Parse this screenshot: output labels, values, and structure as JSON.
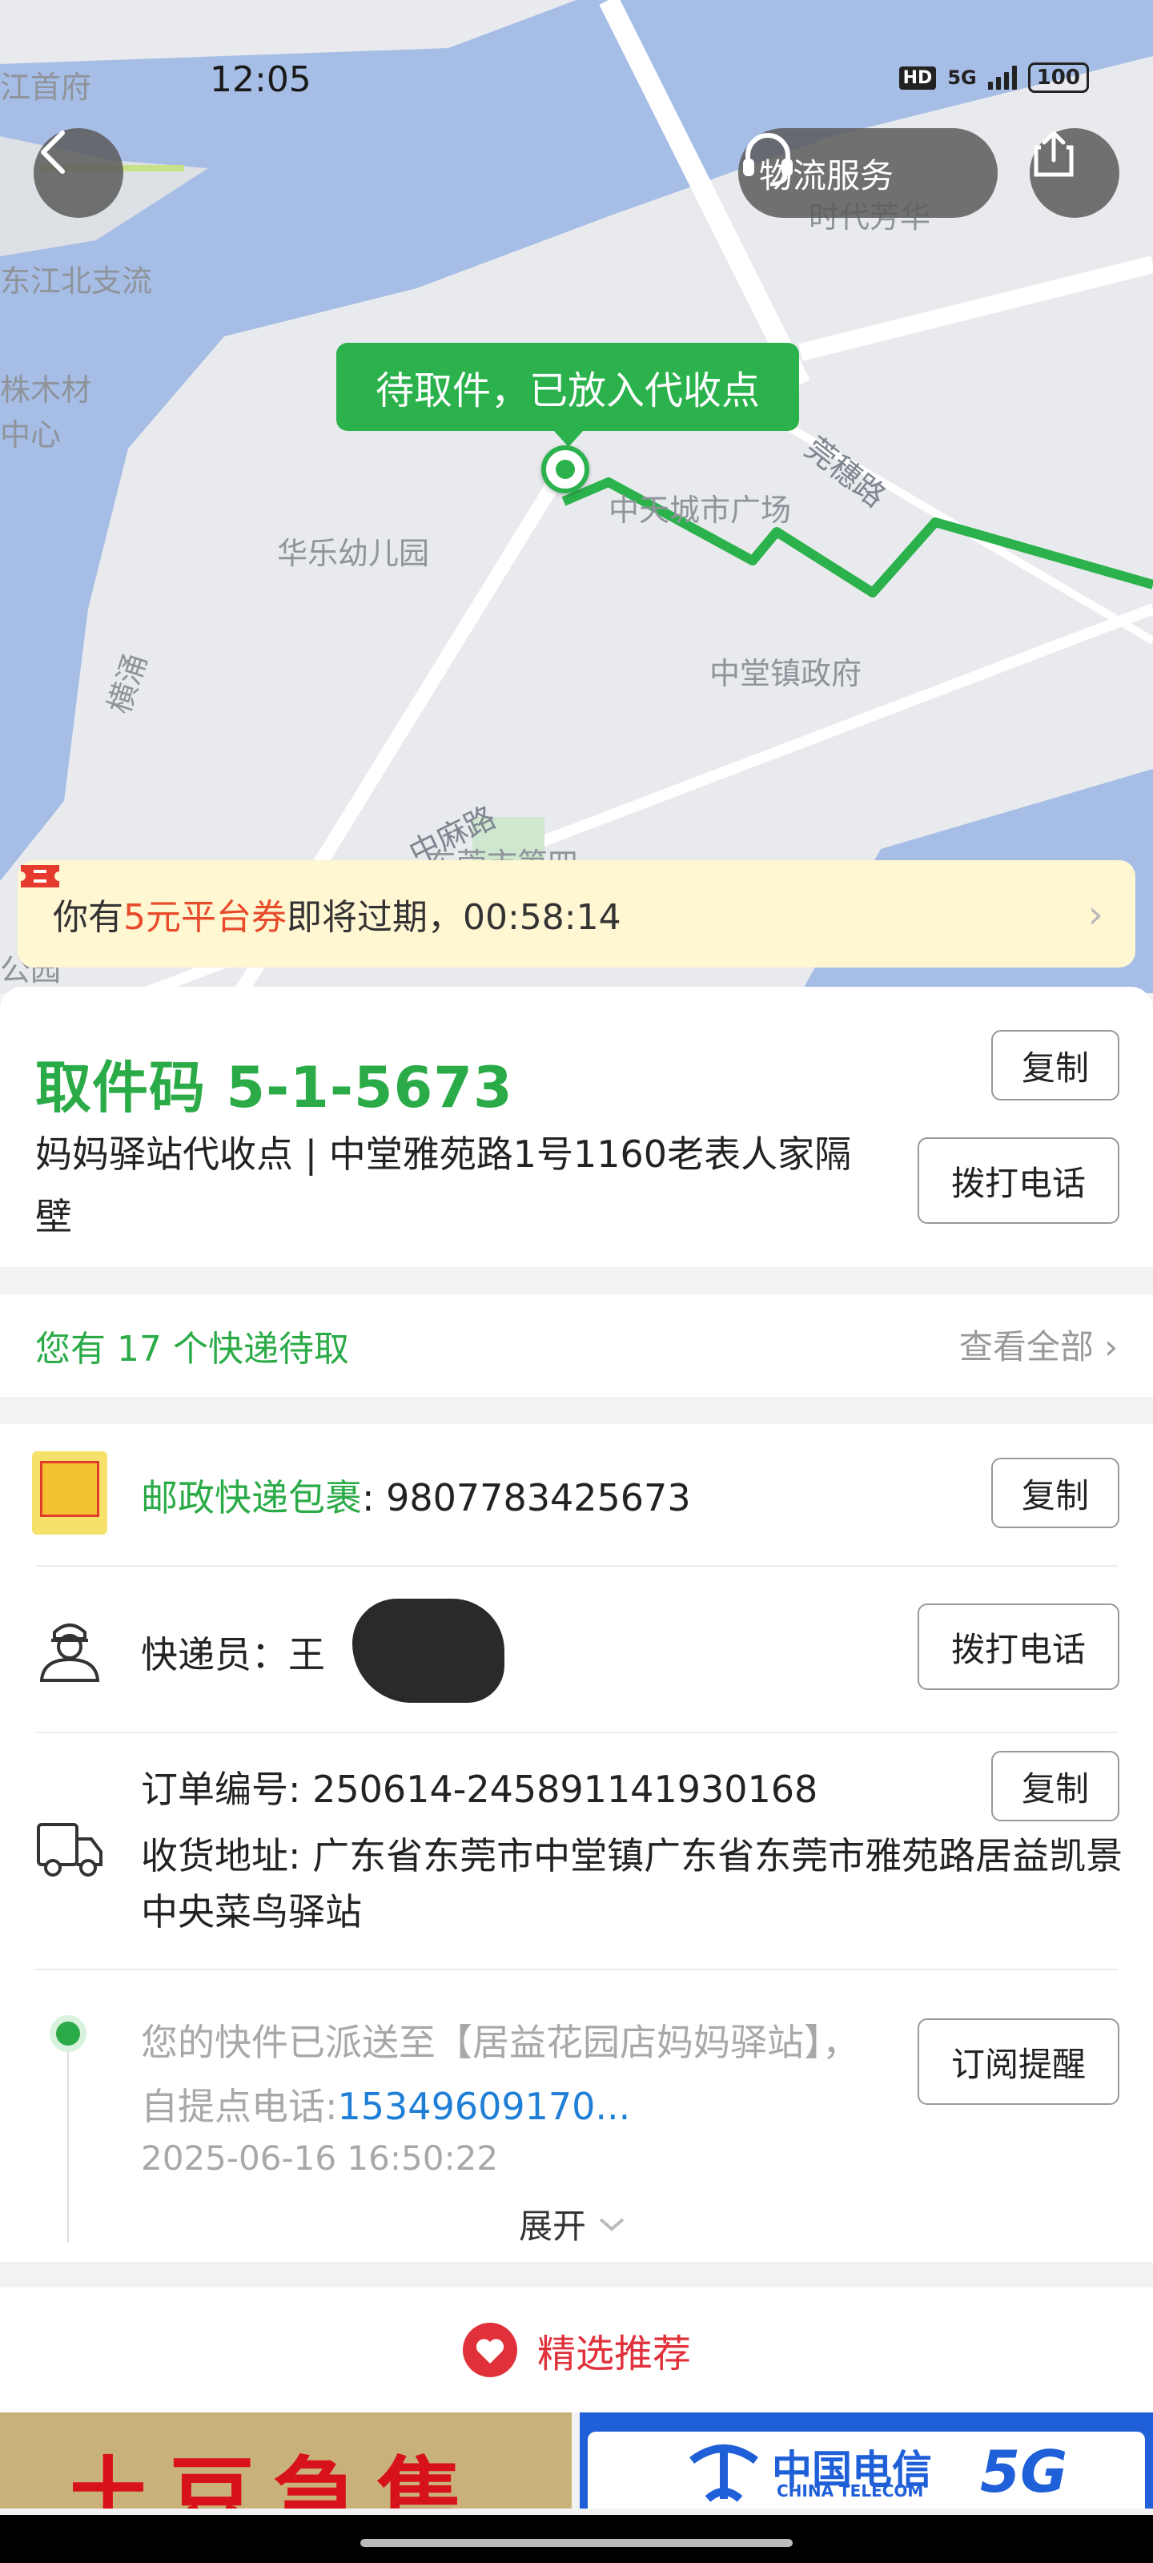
{
  "status_bar": {
    "time": "12:05",
    "hd": "HD",
    "network": "5G",
    "battery": "100"
  },
  "map": {
    "labels": [
      "江首府",
      "东江北支流",
      "株木材",
      "中心",
      "华乐幼儿园",
      "横涌",
      "中天城市广场",
      "莞穗路",
      "中堂镇政府",
      "中麻路",
      "东莞市第四",
      "时代芳华",
      "公园"
    ],
    "service_button": "物流服务",
    "status_bubble": "待取件，已放入代收点",
    "route_color": "#2bb24c"
  },
  "coupon": {
    "prefix": "你有",
    "highlight": "5元平台券",
    "suffix": "即将过期，00:58:14"
  },
  "pickup": {
    "code": "取件码 5-1-5673",
    "address": "妈妈驿站代收点 | 中堂雅苑路1号1160老表人家隔壁",
    "copy_label": "复制",
    "call_label": "拨打电话"
  },
  "pending": {
    "text": "您有 17 个快递待取",
    "view_all": "查看全部"
  },
  "parcel": {
    "carrier": "邮政快递包裹",
    "tracking": ": 9807783425673",
    "copy_label": "复制",
    "courier_label": "快递员：",
    "courier_name": "王",
    "call_label": "拨打电话",
    "order_label": "订单编号: 250614-245891141930168",
    "order_copy_label": "复制",
    "address": "收货地址: 广东省东莞市中堂镇广东省东莞市雅苑路居益凯景中央菜鸟驿站"
  },
  "tracking_event": {
    "message": "您的快件已派送至【居益花园店妈妈驿站】，自提点电话:",
    "phone": "15349609170...",
    "time": "2025-06-16 16:50:22",
    "subscribe_label": "订阅提醒",
    "expand_label": "展开"
  },
  "recommend": {
    "title": "精选推荐"
  },
  "ads": {
    "left_text": "土豆急售",
    "right_name": "中国电信",
    "right_en": "CHINA TELECOM",
    "right_tag": "5G"
  },
  "colors": {
    "accent_green": "#2bab47",
    "coupon_red": "#e84a2a",
    "link_blue": "#1f7ed6",
    "recommend_red": "#e0303a"
  }
}
